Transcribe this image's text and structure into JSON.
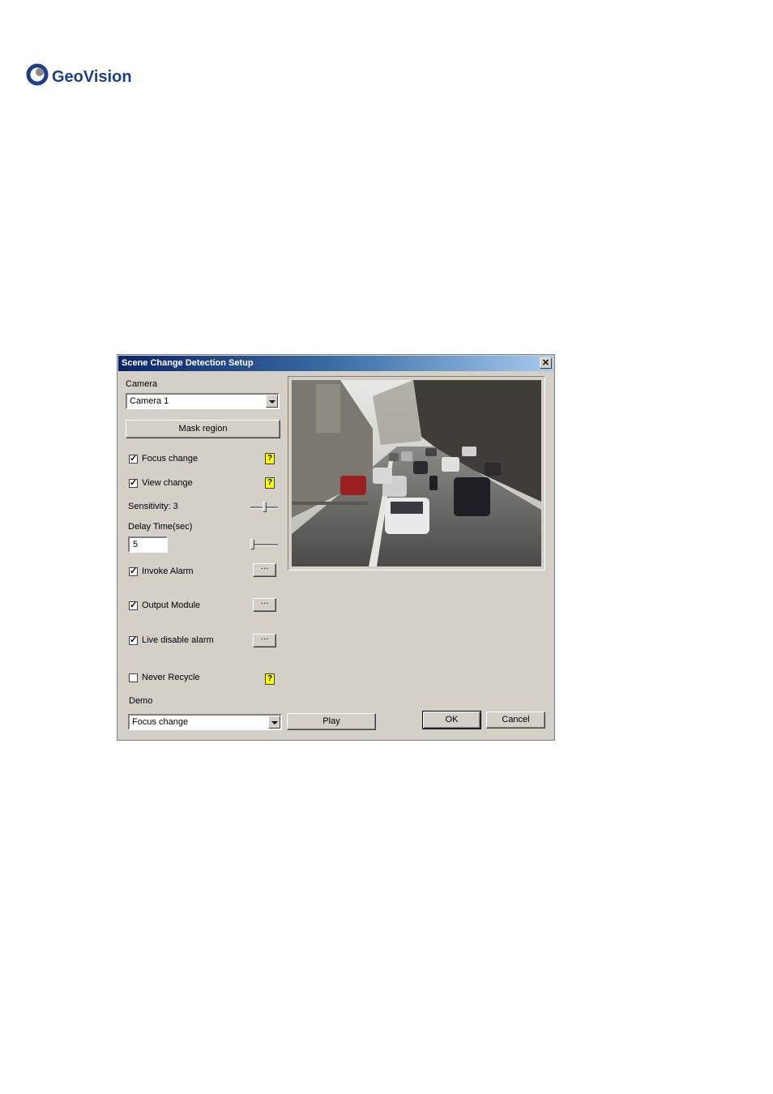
{
  "brand": {
    "name": "GeoVision"
  },
  "dialog": {
    "title": "Scene Change Detection Setup",
    "close_glyph": "✕",
    "camera": {
      "label": "Camera",
      "selected": "Camera 1"
    },
    "mask_region_label": "Mask region",
    "focus_change": {
      "label": "Focus change",
      "checked": true,
      "help": "?"
    },
    "view_change": {
      "label": "View change",
      "checked": true,
      "help": "?"
    },
    "sensitivity": {
      "label": "Sensitivity: 3",
      "value": 3
    },
    "delay_time": {
      "label": "Delay Time(sec)",
      "value": "5"
    },
    "invoke_alarm": {
      "label": "Invoke Alarm",
      "checked": true,
      "button": "..."
    },
    "output_module": {
      "label": "Output Module",
      "checked": true,
      "button": "..."
    },
    "live_disable_alarm": {
      "label": "Live disable alarm",
      "checked": true,
      "button": "..."
    },
    "never_recycle": {
      "label": "Never Recycle",
      "checked": false,
      "help": "?"
    },
    "demo": {
      "label": "Demo",
      "selected": "Focus change"
    },
    "play_label": "Play",
    "ok_label": "OK",
    "cancel_label": "Cancel"
  },
  "colors": {
    "dialog_bg": "#d4d0c8",
    "title_from": "#0a246a",
    "title_to": "#a6caf0",
    "help_icon": "#ffff00",
    "brand_blue": "#1d3f8a"
  }
}
